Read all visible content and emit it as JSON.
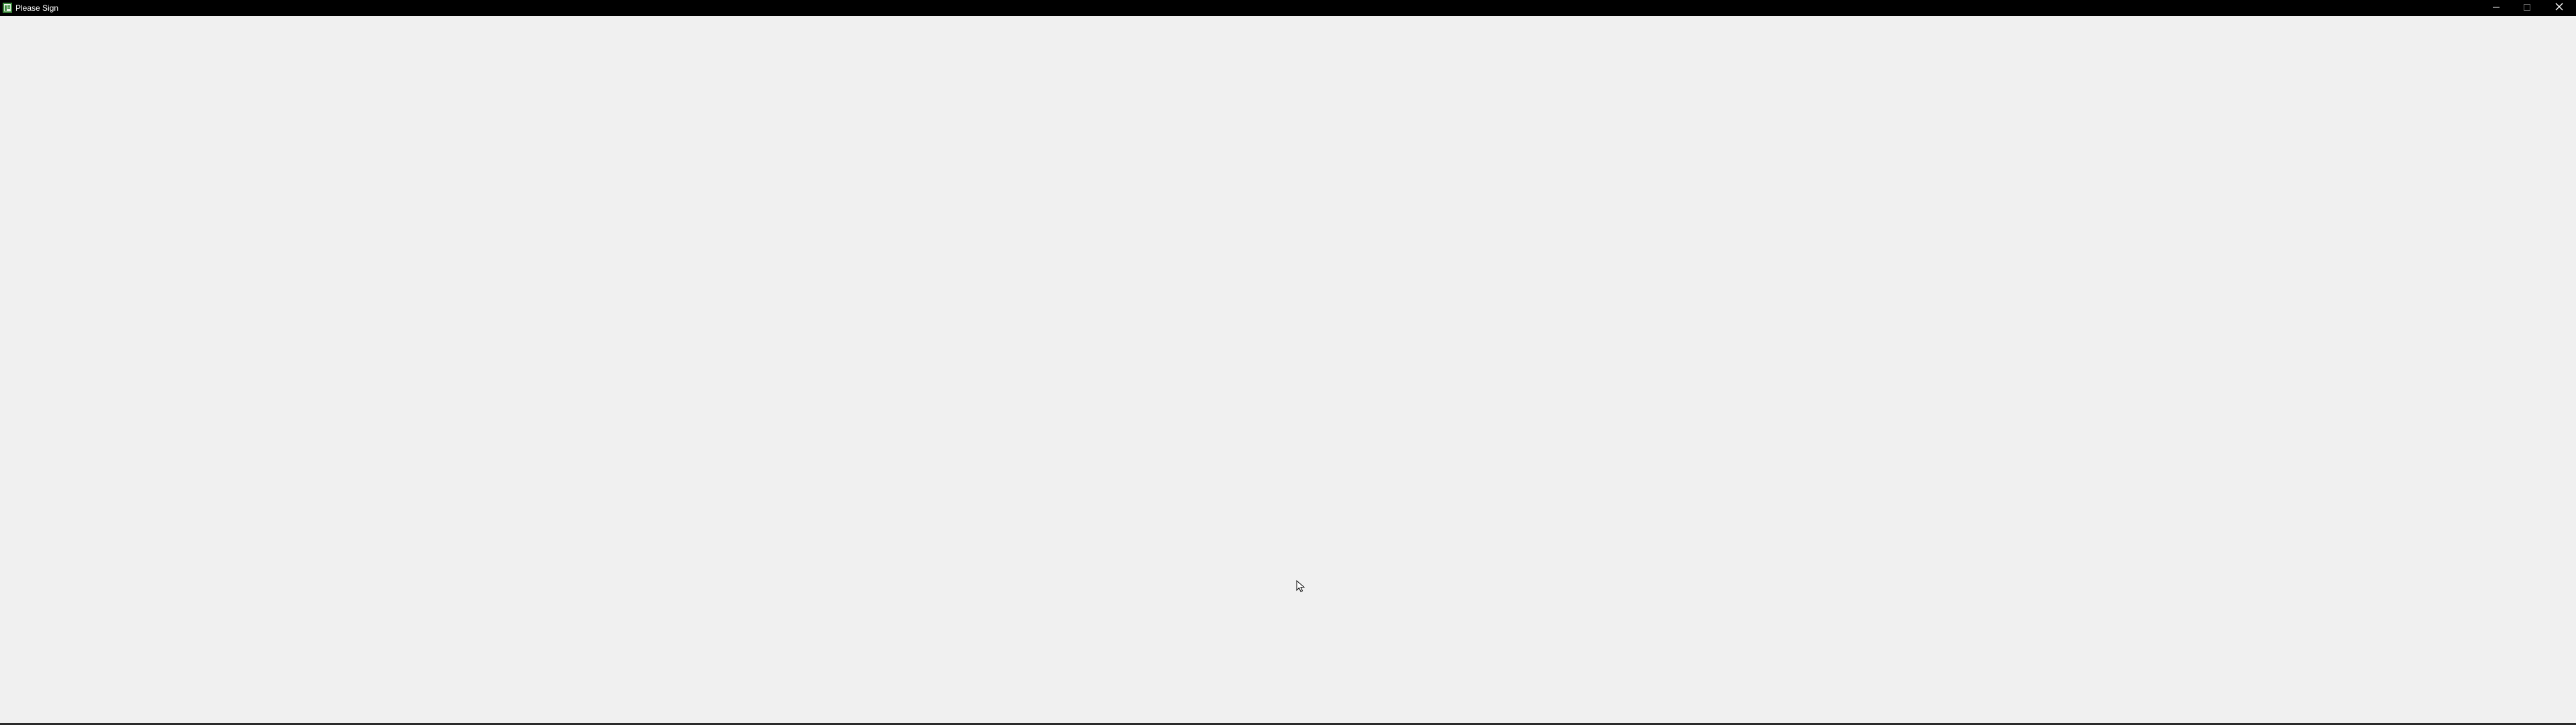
{
  "window": {
    "title": "Please Sign",
    "app_icon": "green-document-icon",
    "controls": {
      "minimize_icon": "minimize-icon",
      "maximize_icon": "maximize-icon",
      "close_icon": "close-icon"
    }
  },
  "colors": {
    "titlebar": "#000000",
    "title_text": "#ffffff",
    "client_background": "#f0f0f0",
    "app_icon_accent": "#3a8a3a"
  }
}
